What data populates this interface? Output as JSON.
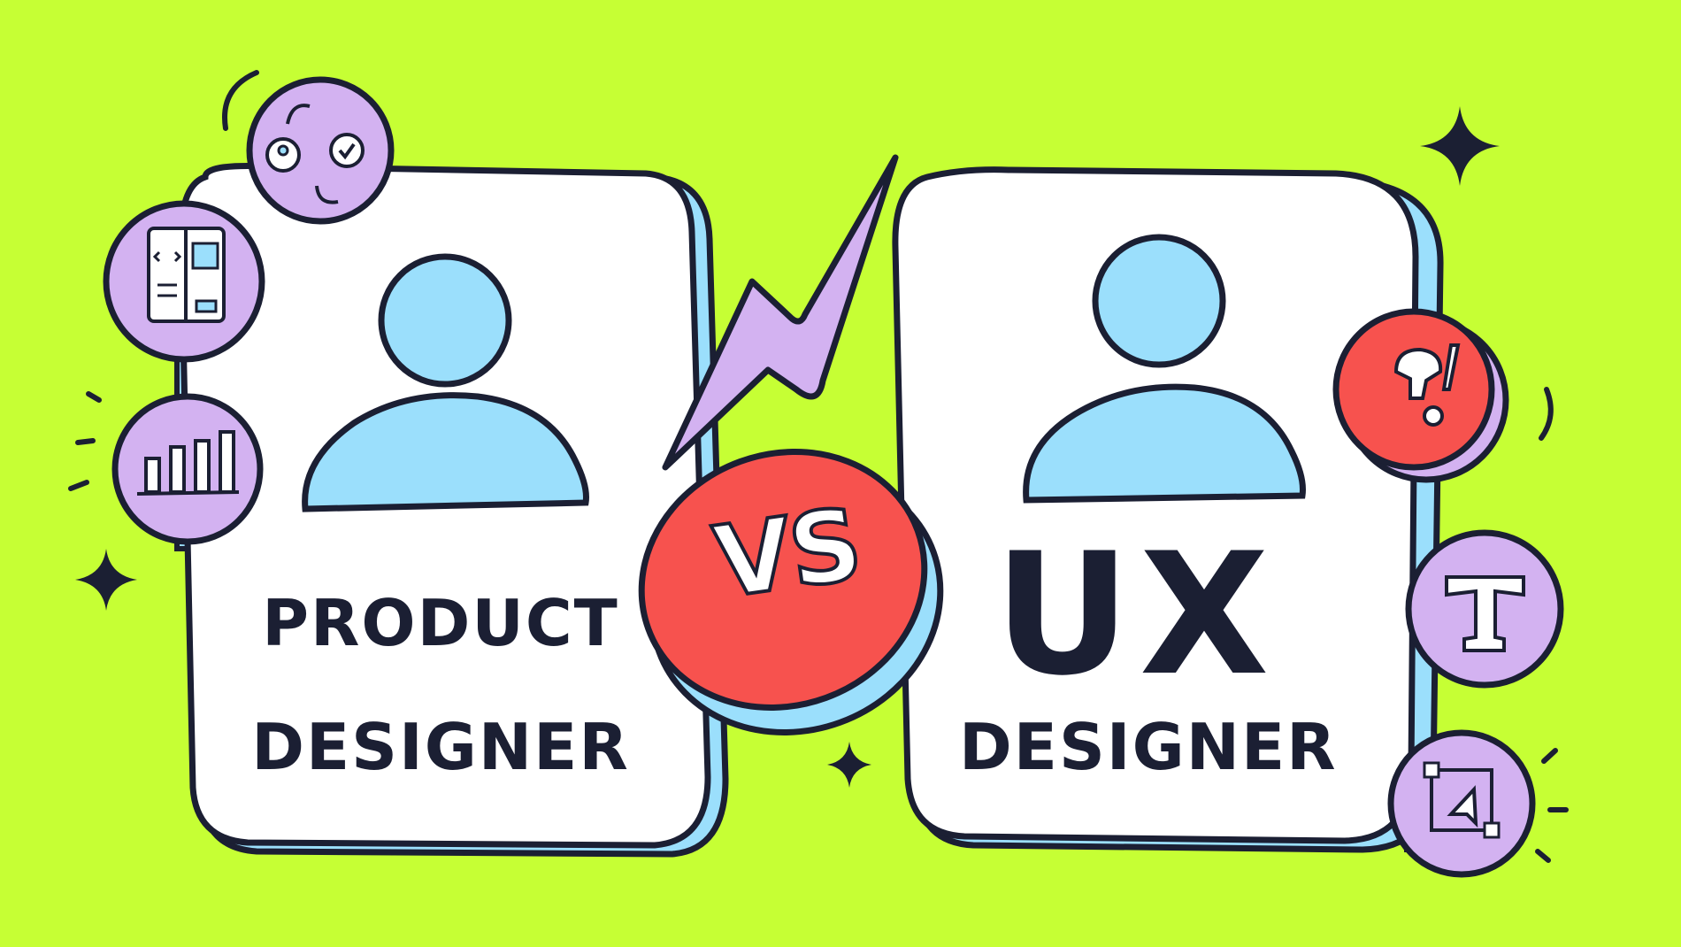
{
  "left_card": {
    "line1": "PRODUCT",
    "line2": "DESIGNER"
  },
  "right_card": {
    "line1": "UX",
    "line2": "DESIGNER"
  },
  "badge": {
    "text": "VS"
  },
  "colors": {
    "background": "#c6ff34",
    "outline": "#1b1f33",
    "avatar": "#9bdffc",
    "purple": "#d3b2f1",
    "red": "#f7524e",
    "card": "#ffffff"
  },
  "icons": [
    "workflow-icon",
    "wireframe-code-icon",
    "bar-chart-icon",
    "question-exclamation-icon",
    "text-tool-icon",
    "selection-cursor-icon",
    "lightning-bolt-icon",
    "sparkle-icon"
  ]
}
